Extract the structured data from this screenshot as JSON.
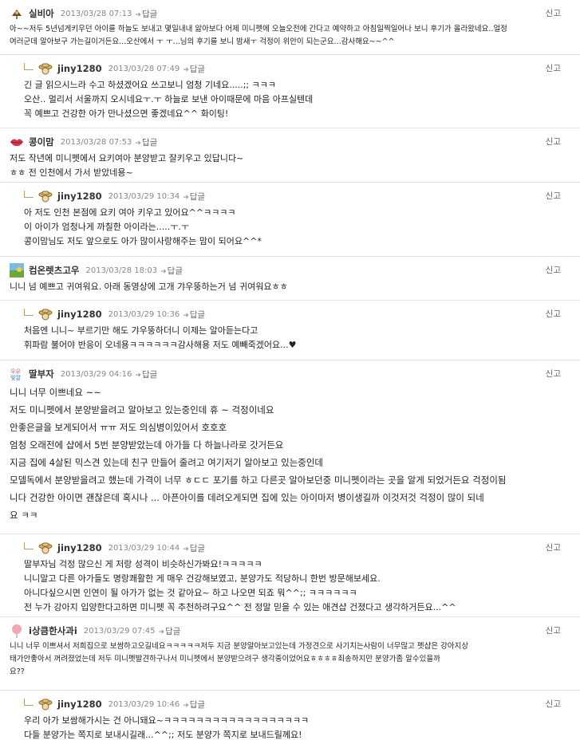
{
  "labels": {
    "reply": "답글",
    "report": "신고"
  },
  "comments": [
    {
      "nick": "실비아",
      "date": "2013/03/28 07:13",
      "lines": [
        "아~~저두 5년넘게키우던 아이를 하늘도 보내고 몇일내내 앓아보다 어제 미니펫에 오늘오전에 간다고 예약하고 아침일찍일어나 보니 후기가 올라왔네요..얼정",
        "여러군데 알아보구 가는길이거든요...오산에서 ㅜ ㅜ...님의 후기를 보니 밤새ㅜ 걱정이 위안이 되는군요...감사해요~~^^"
      ]
    },
    {
      "nick": "jiny1280",
      "date": "2013/03/28 07:49",
      "lines": [
        "긴 글 읽으시느라 수고 하셨겠어요 쓰고보니 엄청 기네요.....;; ㅋㅋㅋ",
        "오산.. 멀리서 서울까지 오시네요ㅜ.ㅜ 하늘로 보낸 아이때문에 마음 아프실텐데",
        "꼭 예쁘고 건강한 아가 만나셨으면 좋겠네요^^ 화이팅!"
      ]
    },
    {
      "nick": "콩이맘",
      "date": "2013/03/28 07:53",
      "lines": [
        "저도 작년에 미니펫에서 요키여아 분양받고 잘키우고 있답니다~",
        "ㅎㅎ 전 인천에서 가서 받았네용~"
      ]
    },
    {
      "nick": "jiny1280",
      "date": "2013/03/29 10:34",
      "lines": [
        "아 저도 인천 본점에 요키 여아 키우고 있어요^^ㅋㅋㅋㅋ",
        "이 아이가 엄청나게 까칠한 아이라는.....ㅜ.ㅜ",
        "콩이맘님도 저도 앞으로도 아가 많이사랑해주는 맘이 되어요^^*"
      ]
    },
    {
      "nick": "컴온렛츠고우",
      "date": "2013/03/28 18:03",
      "lines": [
        "니니 넘 예쁘고 귀여워요. 아래 동영상에 고개 갸우뚱하는거 넘 귀여워요ㅎㅎ"
      ]
    },
    {
      "nick": "jiny1280",
      "date": "2013/03/29 10:36",
      "lines": [
        "처음엔 니니~ 부르기만 해도 갸우뚱하더니 이제는 알아듣는다고",
        "휘파람 불어야 반응이 오네용ㅋㅋㅋㅋㅋㅋ감사해용 저도 예빼죽겠어요...♥"
      ]
    },
    {
      "nick": "딸부자",
      "date": "2013/03/29 04:16",
      "lines": [
        "니니 너무 이쁘네요 ~~",
        "저도 미니펫에서 분양받을려고 알아보고 있는중인데 휴 ~ 걱정이네요",
        "안좋은글을 보게되어서 ㅠㅠ 저도 의심병이있어서 호호호",
        "엄청 오래전에 샵에서 5번 분양받았는데 아가들 다 하늘나라로 갓거든요",
        "지금 집에 4살된 믹스견 있는데 친구 만들어 줄려고 여기저기 알아보고 있는중인데",
        "모델독에서 분양받을려고 했는데 가격이 너무 ㅎㄷㄷ 포기를 하고 다른곳 알아보던중 미니펫이라는 곳을 알게 되었거든요 걱정이됨",
        "니다 건강한 아이면 괜찮은데 혹시나 ... 아픈아이를 데려오게되면 집에 있는 아이마저 병이생길까 이것저것 걱정이 많이 되네",
        "요 ㅋㅋ"
      ]
    },
    {
      "nick": "jiny1280",
      "date": "2013/03/29 10:44",
      "lines": [
        "딸부자님 걱정 많으신 게 저랑 성격이 비슷하신가봐요!ㅋㅋㅋㅋㅋ",
        "니니말고 다른 아가들도 명랑쾌활한 게 매우 건강해보였고, 분양가도 적당하니 한번 방문해보세요.",
        "아니다싶으시면 인연이 될 아가가 없는 것 같아요~ 하고 나오면 되죠 뭐^^;; ㅋㅋㅋㅋㅋㅋ",
        "전 누가 강아지 입양한다고하면 미니펫 꼭 추천하려구요^^ 전 정말 믿을 수 있는 애견샵 건졌다고 생각하거든요...^^"
      ]
    },
    {
      "nick": "i상큼한사과i",
      "date": "2013/03/29 07:45",
      "lines": [
        "니니 너무 이쁘셔서 저희집으로 보쌈하고오길네요ㅋㅋㅋㅋㅋ저두 지금 분양알아보고있는데 가정견으로 사기치는사람이 너무많고 펫샵은 강아지상",
        "태가안좋아서 꺼려졌었는데 저두 미니펫발견하구나서 미니펫에서 분양받으려구 생각중이었어요ㅎㅎㅎㅎ죄송하지만 분양가좀 알수있을까",
        "요??"
      ]
    },
    {
      "nick": "jiny1280",
      "date": "2013/03/29 10:46",
      "lines": [
        "우리 아가 보쌈해가시는 건 아니돼요~ㅋㅋㅋㅋㅋㅋㅋㅋㅋㅋㅋㅋㅋㅋㅋㅋㅋㅋ",
        "다들 분양가는 쪽지로 보내시길래...^^;; 저도 분양가 쪽지로 보내드릴께요!"
      ]
    }
  ]
}
